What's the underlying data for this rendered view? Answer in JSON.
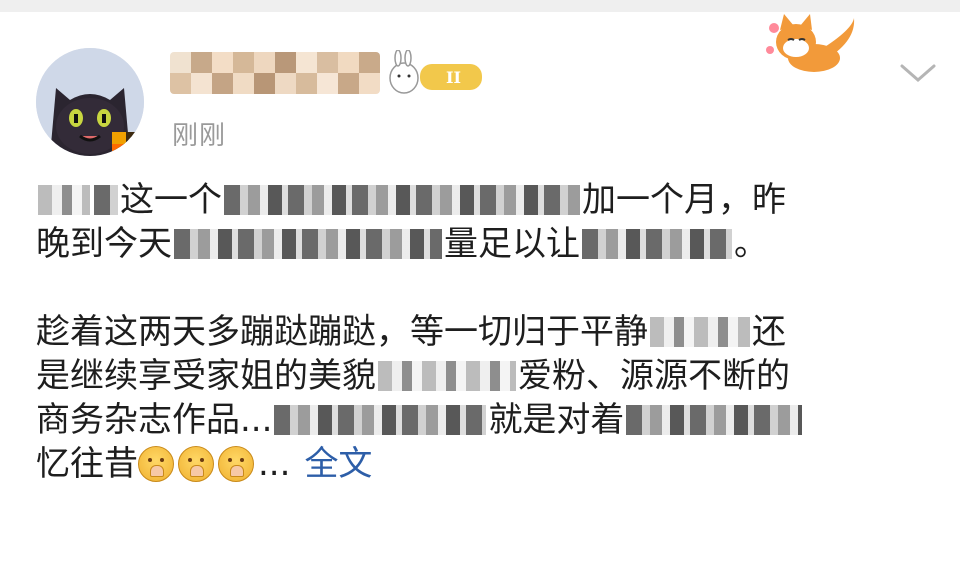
{
  "post": {
    "time": "刚刚",
    "lines": [
      [
        "",
        "这一个",
        "",
        "加一个月，昨"
      ],
      [
        "晚到今天",
        "",
        "量足以让",
        "。"
      ],
      [
        "趁着这两天多蹦跶蹦跶，等一切归于平静",
        "",
        "还"
      ],
      [
        "是继续享受家姐的美貌",
        "",
        "爱粉、源源不断的"
      ],
      [
        "商务杂志作品...",
        "",
        "就是对着",
        ""
      ],
      [
        "忆往昔"
      ]
    ],
    "ellipsis": "...",
    "full_text_link": "全文"
  },
  "icons": [
    "avatar",
    "level-badge-icon",
    "sticker-icon",
    "chevron-down-icon",
    "pray-emoji-icon"
  ],
  "colors": {
    "link": "#2d5ea8",
    "time": "#9a9a9a",
    "text": "#1e1e1e"
  }
}
